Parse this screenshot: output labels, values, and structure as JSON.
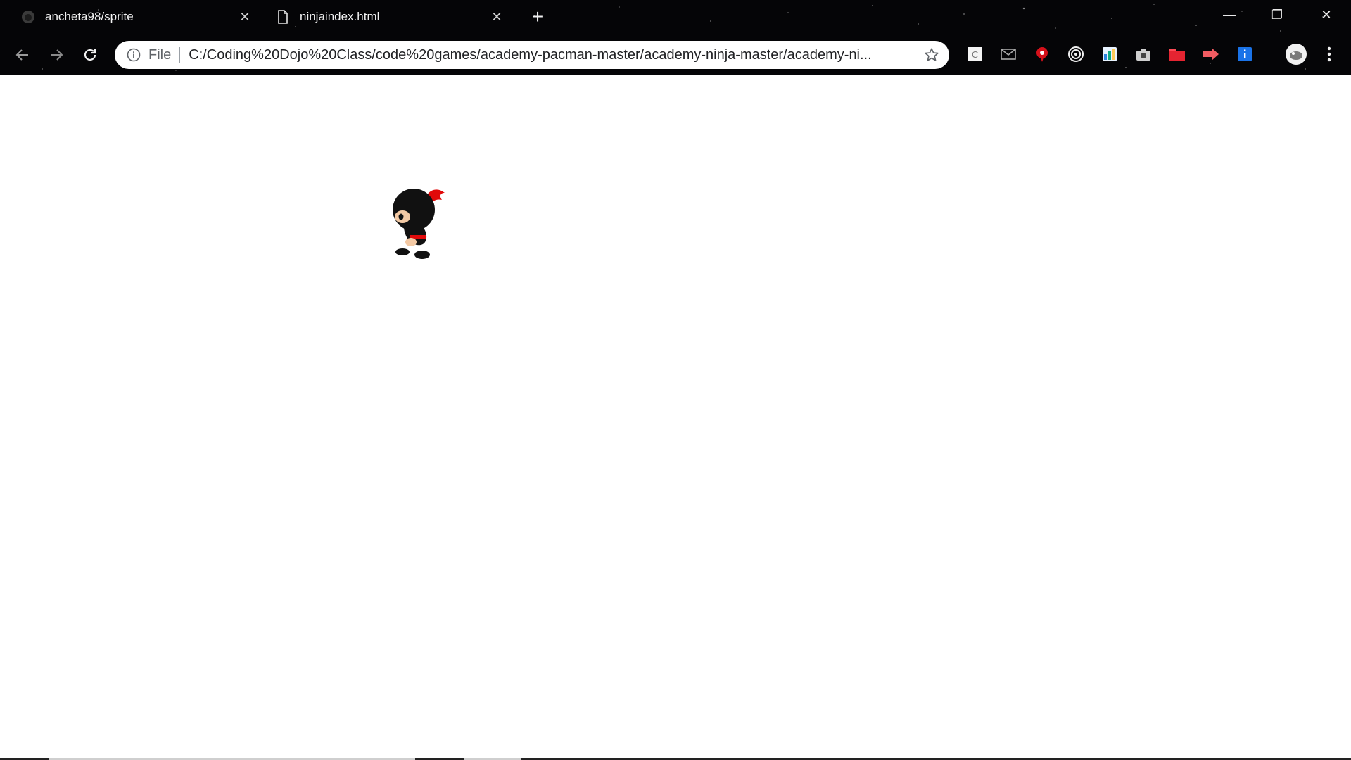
{
  "browser": {
    "tabs": [
      {
        "title": "ancheta98/sprite",
        "icon": "github-icon",
        "active": false
      },
      {
        "title": "ninjaindex.html",
        "icon": "file-icon",
        "active": true
      }
    ],
    "new_tab_label": "+",
    "window_controls": {
      "minimize": "—",
      "restore": "❐",
      "close": "✕"
    },
    "address_bar": {
      "scheme_label": "File",
      "url": "C:/Coding%20Dojo%20Class/code%20games/academy-pacman-master/academy-ninja-master/academy-ni..."
    },
    "extensions": [
      "c-icon",
      "mail-icon",
      "red-pin-icon",
      "target-icon",
      "colorful-tile-icon",
      "camera-icon",
      "red-folder-icon",
      "red-arrow-icon",
      "info-blue-icon"
    ]
  },
  "page": {
    "sprite": "ninja-sprite",
    "colors": {
      "background": "#ffffff",
      "ninja_body": "#111111",
      "ninja_scarf": "#e10a0a",
      "ninja_skin": "#f3c9a4"
    }
  }
}
